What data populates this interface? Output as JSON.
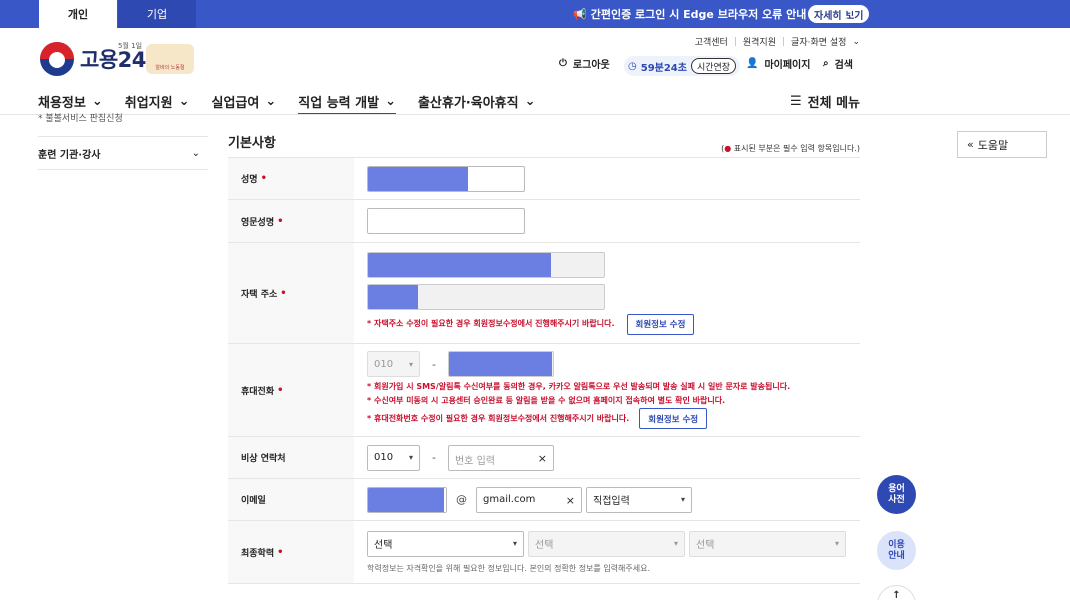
{
  "top_tabs": {
    "personal": "개인",
    "business": "기업"
  },
  "notice": {
    "text": "간편인증 로그인 시 Edge 브라우저 오류 안내",
    "detail_button": "자세히 보기"
  },
  "logo": {
    "name": "고용24",
    "sub": "5월 1일",
    "badge": "알바의 노동절"
  },
  "utility_links": [
    "고객센터",
    "원격지원",
    "글자·화면 설정"
  ],
  "user": {
    "logout": "로그아웃",
    "timer": "59분24초",
    "extend": "시간연장",
    "mypage": "마이페이지",
    "search": "검색"
  },
  "gnb": [
    "채용정보",
    "취업지원",
    "실업급여",
    "직업 능력 개발",
    "출산휴가·육아휴직"
  ],
  "all_menu": "전체 메뉴",
  "lnb": {
    "partial": "* 불볼서비스 판집신청",
    "item": "훈련 기관·강사"
  },
  "help_button": "도움말",
  "section": {
    "title": "기본사항",
    "required_note_prefix": "(",
    "required_note": " 표시된 부분은 필수 입력 항목입니다.)"
  },
  "rows": {
    "name": {
      "label": "성명"
    },
    "eng_name": {
      "label": "영문성명",
      "value": ""
    },
    "address": {
      "label": "자택 주소",
      "warn": "* 자택주소 수정이 필요한 경우 회원정보수정에서 진행해주시기 바랍니다.",
      "button": "회원정보 수정"
    },
    "mobile": {
      "label": "휴대전화",
      "prefix": "010",
      "warn1": "* 회원가입 시 SMS/알림톡 수신여부를 동의한 경우, 카카오 알림톡으로 우선 발송되며 발송 실패 시 일반 문자로 발송됩니다.",
      "warn2": "* 수신여부 미동의 시 고용센터 승인완료 등 알림을 받을 수 없으며 홈페이지 접속하여 별도 확인 바랍니다.",
      "warn3": "* 휴대전화번호 수정이 필요한 경우 회원정보수정에서 진행해주시기 바랍니다.",
      "button": "회원정보 수정"
    },
    "emergency": {
      "label": "비상 연락처",
      "prefix": "010",
      "placeholder": "번호 입력"
    },
    "email": {
      "label": "이메일",
      "domain": "gmail.com",
      "domain_select": "직접입력"
    },
    "education": {
      "label": "최종학력",
      "select1": "선택",
      "select2": "선택",
      "select3": "선택",
      "info": "학력정보는 자격확인을 위해 필요한 정보입니다. 본인의 정확한 정보를 입력해주세요."
    }
  },
  "floating": {
    "dict": "용어\n사전",
    "dict_line1": "용어",
    "dict_line2": "사전",
    "guide_line1": "이용",
    "guide_line2": "안내",
    "top": "↑"
  },
  "colors": {
    "brand": "#3a57c8",
    "required": "#c8102e",
    "mask": "#6b7fe3"
  }
}
